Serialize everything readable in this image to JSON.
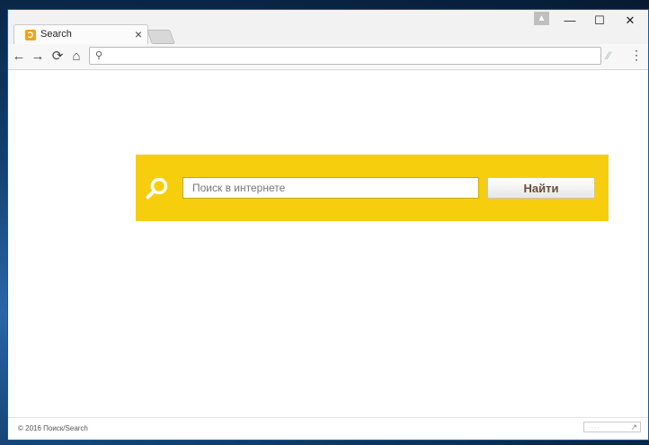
{
  "tab": {
    "title": "Search",
    "favicon_glyph": "Ↄ"
  },
  "window_controls": {
    "minimize": "—",
    "maximize": "☐",
    "close": "✕"
  },
  "toolbar": {
    "back": "←",
    "forward": "→",
    "reload": "⟳",
    "home": "⌂"
  },
  "omnibox": {
    "value": "",
    "icon": "search-icon"
  },
  "search": {
    "placeholder": "Поиск в интернете",
    "button_label": "Найти",
    "accent_color": "#f7ce0e"
  },
  "footer": {
    "copyright": "© 2016  Поиск/Search"
  }
}
